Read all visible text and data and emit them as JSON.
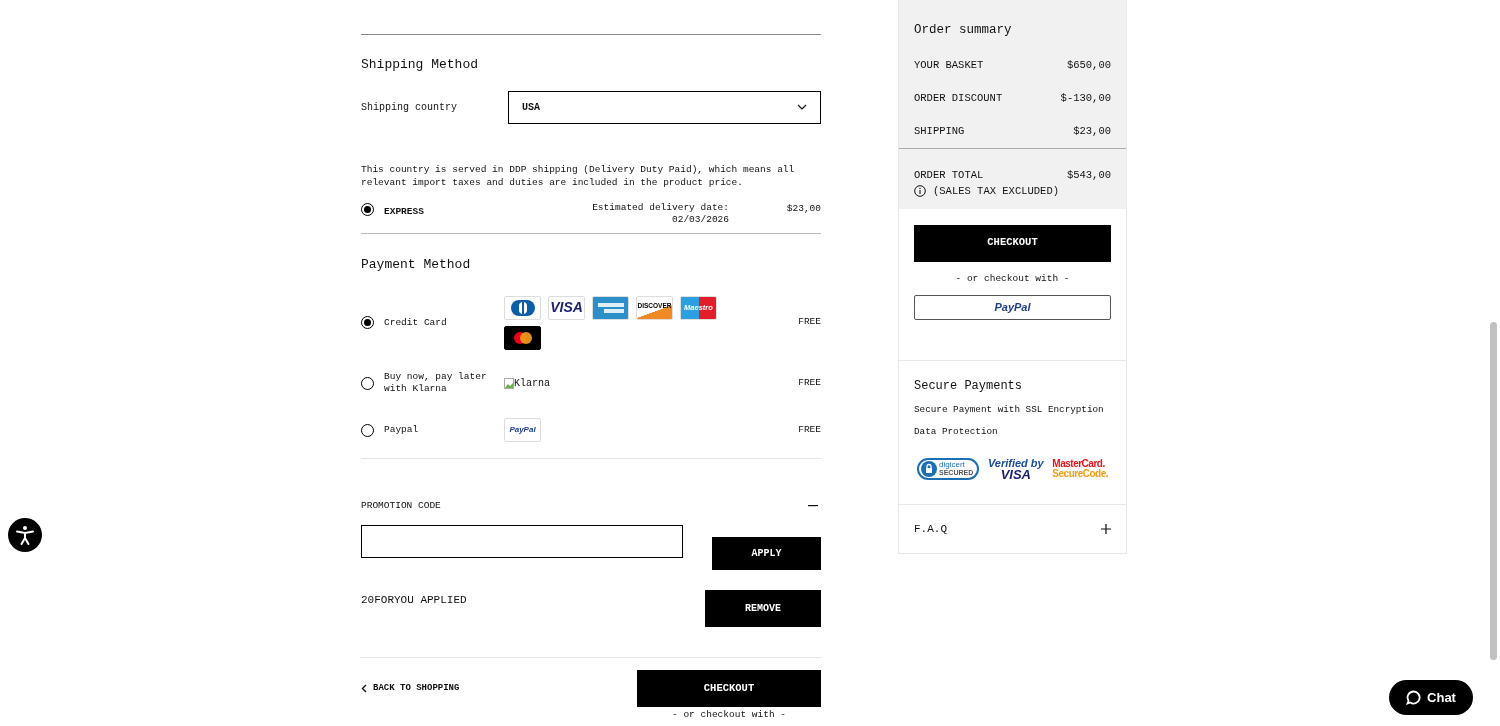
{
  "shipping": {
    "title": "Shipping Method",
    "country_label": "Shipping country",
    "country_value": "USA",
    "note": "This country is served in DDP shipping (Delivery Duty Paid), which means all relevant import taxes and duties are included in the product price.",
    "options": [
      {
        "label": "EXPRESS",
        "selected": true,
        "estimate_label": "Estimated delivery date:",
        "estimate_date": "02/03/2026",
        "price": "$23,00"
      }
    ]
  },
  "payment": {
    "title": "Payment Method",
    "methods": [
      {
        "kind": "cards",
        "label": "Credit Card",
        "selected": true,
        "price": "FREE",
        "logos": [
          {
            "kind": "diners"
          },
          {
            "kind": "visa",
            "text": "VISA"
          },
          {
            "kind": "amex"
          },
          {
            "kind": "discover",
            "text": "DISCOVER"
          },
          {
            "kind": "maestro",
            "text": "Maestro"
          },
          {
            "kind": "mastercard"
          }
        ]
      },
      {
        "kind": "image_alt",
        "label": "Buy now, pay later with Klarna",
        "selected": false,
        "price": "FREE",
        "alt": "Klarna"
      },
      {
        "kind": "paypal",
        "label": "Paypal",
        "selected": false,
        "price": "FREE",
        "logo_text": "PayPal"
      }
    ]
  },
  "promotion": {
    "title": "PROMOTION CODE",
    "expanded": true,
    "apply_button": "APPLY",
    "applied": "20FORYOU APPLIED",
    "remove_button": "REMOVE"
  },
  "footer": {
    "back_link": "BACK TO SHOPPING",
    "checkout_button": "CHECKOUT",
    "alt_text": "- or checkout with -"
  },
  "summary": {
    "title": "Order summary",
    "rows": [
      {
        "label": "YOUR BASKET",
        "value": "$650,00"
      },
      {
        "label": "ORDER DISCOUNT",
        "value": "$-130,00"
      },
      {
        "label": "SHIPPING",
        "value": "$23,00"
      }
    ],
    "total": {
      "label": "ORDER TOTAL",
      "value": "$543,00",
      "note": "(SALES TAX EXCLUDED)"
    },
    "checkout_button": "CHECKOUT",
    "alt_text": "- or checkout with -",
    "paypal_button": "PayPal"
  },
  "secure": {
    "title": "Secure Payments",
    "lines": [
      "Secure Payment with SSL Encryption",
      "Data Protection"
    ],
    "badges": [
      {
        "kind": "digicert",
        "lines": [
          "digicert",
          "SECURED"
        ]
      },
      {
        "kind": "visa",
        "lines": [
          "Verified by",
          "VISA"
        ]
      },
      {
        "kind": "mastercard",
        "lines": [
          "MasterCard.",
          "SecureCode."
        ]
      }
    ]
  },
  "faq": {
    "label": "F.A.Q",
    "expanded": false
  },
  "chat": {
    "label": "Chat"
  }
}
